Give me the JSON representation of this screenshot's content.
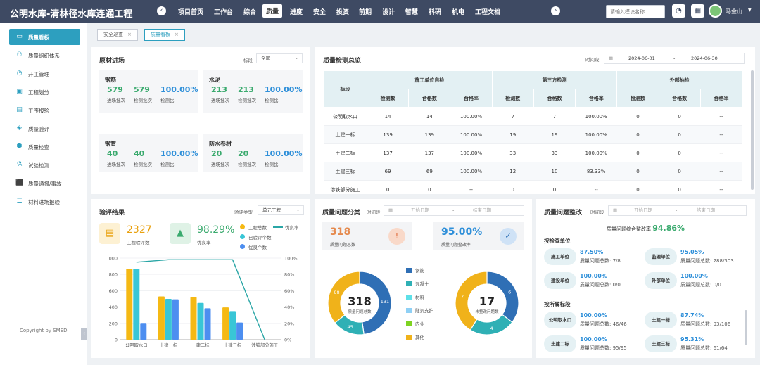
{
  "app": {
    "title": "公明水库-清林径水库连通工程"
  },
  "nav": {
    "items": [
      {
        "label": "项目首页",
        "active": false
      },
      {
        "label": "工作台",
        "active": false
      },
      {
        "label": "综合",
        "active": false
      },
      {
        "label": "质量",
        "active": true
      },
      {
        "label": "进度",
        "active": false
      },
      {
        "label": "安全",
        "active": false
      },
      {
        "label": "投资",
        "active": false
      },
      {
        "label": "前期",
        "active": false
      },
      {
        "label": "设计",
        "active": false
      },
      {
        "label": "智慧",
        "active": false
      },
      {
        "label": "科研",
        "active": false
      },
      {
        "label": "机电",
        "active": false
      },
      {
        "label": "工程文档",
        "active": false
      }
    ],
    "search_placeholder": "请输入模块名称",
    "user_name": "马金山"
  },
  "sidebar": {
    "items": [
      {
        "label": "质量看板",
        "icon": "board-icon",
        "active": true
      },
      {
        "label": "质量组织体系",
        "icon": "org-icon",
        "active": false
      },
      {
        "label": "开工管理",
        "icon": "alarm-icon",
        "active": false
      },
      {
        "label": "工程划分",
        "icon": "briefcase-icon",
        "active": false
      },
      {
        "label": "工序报验",
        "icon": "document-icon",
        "active": false
      },
      {
        "label": "质量验评",
        "icon": "shield-icon",
        "active": false
      },
      {
        "label": "质量检查",
        "icon": "stamp-icon",
        "active": false
      },
      {
        "label": "试验检测",
        "icon": "flask-icon",
        "active": false
      },
      {
        "label": "质量通报/事故",
        "icon": "notice-icon",
        "active": false
      },
      {
        "label": "材料进场报验",
        "icon": "list-icon",
        "active": false
      }
    ],
    "copyright": "Copyright by SMEDI"
  },
  "tabs": [
    {
      "label": "安全巡查",
      "active": false
    },
    {
      "label": "质量看板",
      "active": true
    }
  ],
  "materials": {
    "title": "原材进场",
    "filter_label": "标段",
    "filter_value": "全部",
    "cards": [
      {
        "name": "钢筋",
        "in_batches": "579",
        "checked_batches": "579",
        "ratio": "100.00%"
      },
      {
        "name": "水泥",
        "in_batches": "213",
        "checked_batches": "213",
        "ratio": "100.00%"
      },
      {
        "name": "钢管",
        "in_batches": "40",
        "checked_batches": "40",
        "ratio": "100.00%"
      },
      {
        "name": "防水卷材",
        "in_batches": "20",
        "checked_batches": "20",
        "ratio": "100.00%"
      }
    ],
    "sub_labels": {
      "in": "进场批次",
      "checked": "检测批次",
      "ratio": "检测比"
    }
  },
  "inspection": {
    "title": "质量检测总览",
    "date_label": "时间段",
    "date_from": "2024-06-01",
    "date_sep": "-",
    "date_to": "2024-06-30",
    "header_section": "标段",
    "groups": [
      "施工单位自检",
      "第三方检测",
      "外部抽检"
    ],
    "cols": [
      "检测数",
      "合格数",
      "合格率",
      "检测数",
      "合格数",
      "合格率",
      "检测数",
      "合格数",
      "合格率"
    ],
    "rows": [
      {
        "name": "公明取水口",
        "cells": [
          "14",
          "14",
          "100.00%",
          "7",
          "7",
          "100.00%",
          "0",
          "0",
          "--"
        ]
      },
      {
        "name": "土建一标",
        "cells": [
          "139",
          "139",
          "100.00%",
          "19",
          "19",
          "100.00%",
          "0",
          "0",
          "--"
        ]
      },
      {
        "name": "土建二标",
        "cells": [
          "137",
          "137",
          "100.00%",
          "33",
          "33",
          "100.00%",
          "0",
          "0",
          "--"
        ]
      },
      {
        "name": "土建三标",
        "cells": [
          "69",
          "69",
          "100.00%",
          "12",
          "10",
          "83.33%",
          "0",
          "0",
          "--"
        ]
      },
      {
        "name": "涉铁部分施工",
        "cells": [
          "0",
          "0",
          "--",
          "0",
          "0",
          "--",
          "0",
          "0",
          "--"
        ]
      }
    ]
  },
  "evaluation": {
    "title": "验评结果",
    "filter_label": "验评类型",
    "filter_value": "单元工程",
    "total_value": "2327",
    "total_label": "工程验评数",
    "rate_value": "98.29%",
    "rate_label": "优良率",
    "legend": [
      "工程总数",
      "优良率",
      "已验评个数",
      "优良个数"
    ]
  },
  "chart_data": {
    "type": "bar",
    "categories": [
      "公明取水口",
      "土建一标",
      "土建二标",
      "土建三标",
      "涉铁部分施工"
    ],
    "series": [
      {
        "name": "工程总数",
        "type": "bar",
        "color": "#f5b914",
        "values": [
          870,
          530,
          520,
          395,
          0
        ]
      },
      {
        "name": "已验评个数",
        "type": "bar",
        "color": "#39c6d6",
        "values": [
          870,
          500,
          450,
          350,
          0
        ]
      },
      {
        "name": "优良个数",
        "type": "bar",
        "color": "#4d8ef0",
        "values": [
          205,
          495,
          385,
          210,
          0
        ]
      },
      {
        "name": "优良率",
        "type": "line",
        "axis": "right",
        "color": "#2aa6a6",
        "values": [
          95,
          98,
          98,
          98,
          0
        ]
      }
    ],
    "ylim": [
      0,
      1000
    ],
    "yticks": [
      "0",
      "200",
      "400",
      "600",
      "800",
      "1,000"
    ],
    "y2lim": [
      0,
      100
    ],
    "y2ticks": [
      "0%",
      "20%",
      "40%",
      "60%",
      "80%",
      "100%"
    ],
    "grid": true
  },
  "problems": {
    "title": "质量问题分类",
    "date_label": "时间段",
    "date_from": "开始日期",
    "date_sep": "-",
    "date_to": "结束日期",
    "total_value": "318",
    "total_label": "质量问题总数",
    "rate_value": "95.00%",
    "rate_label": "质量问题整改率",
    "donut1": {
      "center_value": "318",
      "center_label": "质量问题总数",
      "values": [
        131,
        45,
        98
      ]
    },
    "donut2": {
      "center_value": "17",
      "center_label": "未整改问题数",
      "values": [
        6,
        4,
        7
      ]
    },
    "legend": [
      {
        "label": "钢筋",
        "color": "#2f6fb5"
      },
      {
        "label": "混凝土",
        "color": "#2fb0b5"
      },
      {
        "label": "材料",
        "color": "#5ee0e8"
      },
      {
        "label": "隧洞支护",
        "color": "#8fd0f5"
      },
      {
        "label": "内业",
        "color": "#7ed321"
      },
      {
        "label": "其他",
        "color": "#f0b21a"
      }
    ]
  },
  "rectification": {
    "title": "质量问题整改",
    "date_label": "时间段",
    "date_from": "开始日期",
    "date_sep": "-",
    "date_to": "结束日期",
    "overall_label": "质量问题综合整改率",
    "overall_value": "94.86%",
    "by_unit_label": "按检查单位",
    "by_section_label": "按所属标段",
    "units": [
      {
        "name": "施工单位",
        "rate": "87.50%",
        "total": "质量问题总数: 7/8"
      },
      {
        "name": "监理单位",
        "rate": "95.05%",
        "total": "质量问题总数: 288/303"
      },
      {
        "name": "建设单位",
        "rate": "100.00%",
        "total": "质量问题总数: 0/0"
      },
      {
        "name": "外部单位",
        "rate": "100.00%",
        "total": "质量问题总数: 0/0"
      }
    ],
    "sections": [
      {
        "name": "公明取水口",
        "rate": "100.00%",
        "total": "质量问题总数: 46/46"
      },
      {
        "name": "土建一标",
        "rate": "87.74%",
        "total": "质量问题总数: 93/106"
      },
      {
        "name": "土建二标",
        "rate": "100.00%",
        "total": "质量问题总数: 95/95"
      },
      {
        "name": "土建三标",
        "rate": "95.31%",
        "total": "质量问题总数: 61/64"
      }
    ]
  }
}
